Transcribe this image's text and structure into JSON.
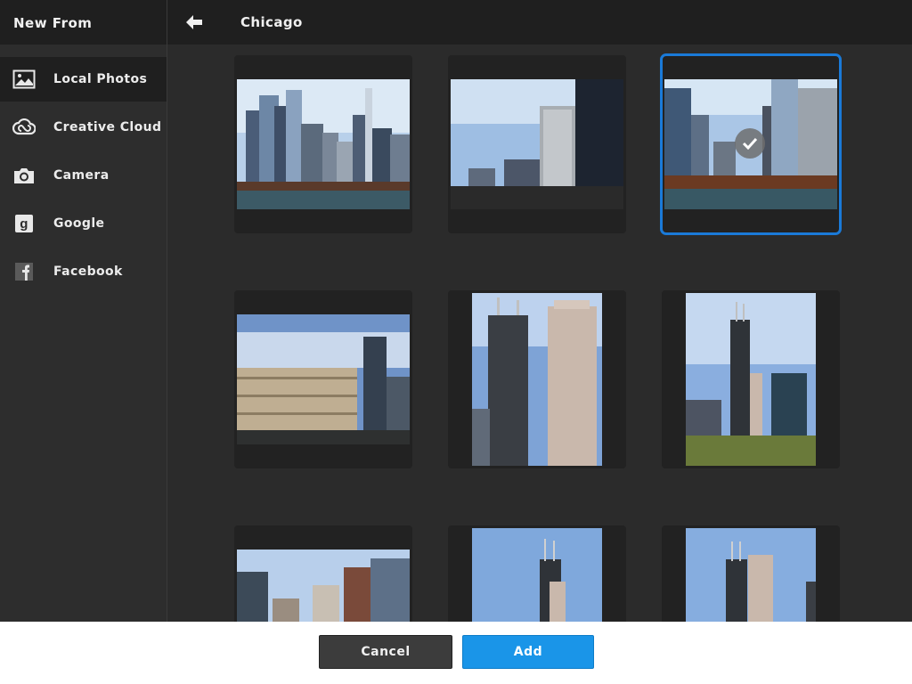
{
  "sidebar": {
    "title": "New From",
    "items": [
      {
        "label": "Local Photos",
        "icon": "photo-icon",
        "active": true
      },
      {
        "label": "Creative Cloud",
        "icon": "creative-cloud-icon",
        "active": false
      },
      {
        "label": "Camera",
        "icon": "camera-icon",
        "active": false
      },
      {
        "label": "Google",
        "icon": "google-icon",
        "active": false
      },
      {
        "label": "Facebook",
        "icon": "facebook-icon",
        "active": false
      }
    ]
  },
  "header": {
    "back_icon": "back-arrow-icon",
    "album_title": "Chicago"
  },
  "photos": [
    {
      "name": "photo-1",
      "orientation": "landscape",
      "selected": false
    },
    {
      "name": "photo-2",
      "orientation": "landscape",
      "selected": false
    },
    {
      "name": "photo-3",
      "orientation": "landscape",
      "selected": true
    },
    {
      "name": "photo-4",
      "orientation": "landscape",
      "selected": false
    },
    {
      "name": "photo-5",
      "orientation": "portrait",
      "selected": false
    },
    {
      "name": "photo-6",
      "orientation": "portrait",
      "selected": false
    },
    {
      "name": "photo-7",
      "orientation": "landscape",
      "selected": false
    },
    {
      "name": "photo-8",
      "orientation": "portrait",
      "selected": false
    },
    {
      "name": "photo-9",
      "orientation": "portrait",
      "selected": false
    }
  ],
  "footer": {
    "cancel_label": "Cancel",
    "add_label": "Add"
  },
  "colors": {
    "accent": "#1a95e8",
    "selection": "#1a7ad8"
  }
}
